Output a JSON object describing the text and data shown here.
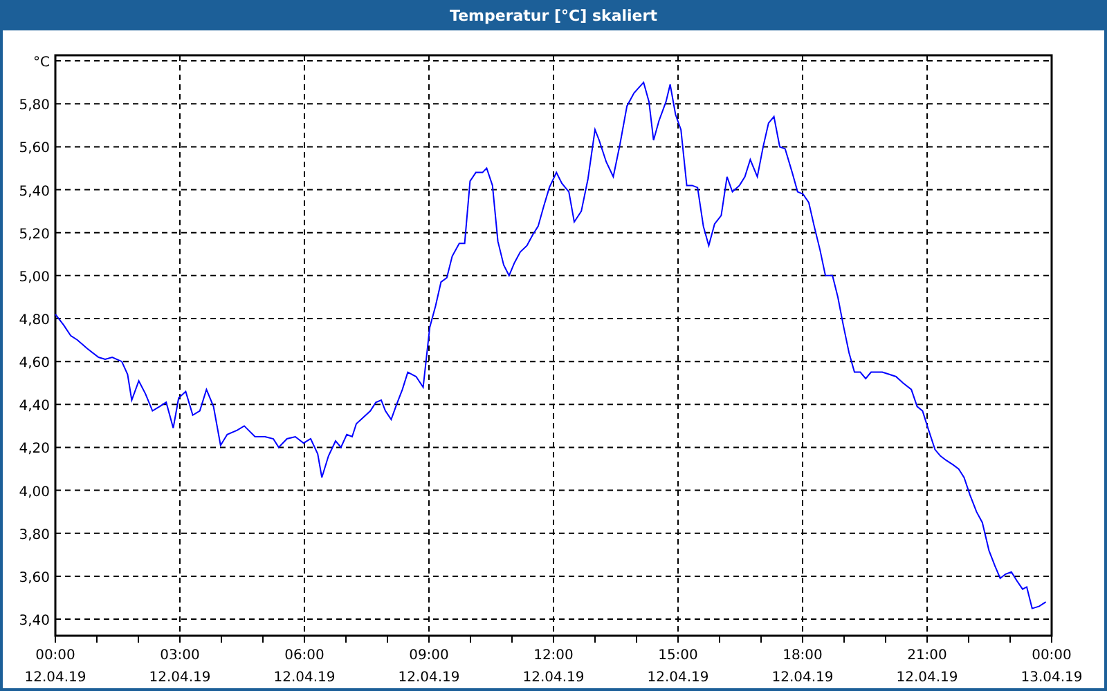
{
  "chart_data": {
    "type": "line",
    "title": "Temperatur [°C] skaliert",
    "grid": true,
    "xlim": [
      0,
      24
    ],
    "ylim": [
      3.323,
      6.026
    ],
    "xticks": [
      {
        "value": 0,
        "label": "00:00"
      },
      {
        "value": 3,
        "label": "03:00"
      },
      {
        "value": 6,
        "label": "06:00"
      },
      {
        "value": 9,
        "label": "09:00"
      },
      {
        "value": 12,
        "label": "12:00"
      },
      {
        "value": 15,
        "label": "15:00"
      },
      {
        "value": 18,
        "label": "18:00"
      },
      {
        "value": 21,
        "label": "21:00"
      },
      {
        "value": 24,
        "label": "00:00"
      }
    ],
    "annotations": [
      "12.04.19",
      "12.04.19",
      "12.04.19",
      "12.04.19",
      "12.04.19",
      "12.04.19",
      "12.04.19",
      "12.04.19",
      "13.04.19"
    ],
    "yticks": [
      {
        "value": 3.4,
        "label": "3,40"
      },
      {
        "value": 3.6,
        "label": "3,60"
      },
      {
        "value": 3.8,
        "label": "3,80"
      },
      {
        "value": 4.0,
        "label": "4,00"
      },
      {
        "value": 4.2,
        "label": "4,20"
      },
      {
        "value": 4.4,
        "label": "4,40"
      },
      {
        "value": 4.6,
        "label": "4,60"
      },
      {
        "value": 4.8,
        "label": "4,80"
      },
      {
        "value": 5.0,
        "label": "5,00"
      },
      {
        "value": 5.2,
        "label": "5,20"
      },
      {
        "value": 5.4,
        "label": "5,40"
      },
      {
        "value": 5.6,
        "label": "5,60"
      },
      {
        "value": 5.8,
        "label": "5,80"
      },
      {
        "value": 6.0,
        "label": "°C"
      }
    ],
    "x": [
      0,
      0.2,
      0.37,
      0.53,
      0.77,
      1.04,
      1.2,
      1.37,
      1.6,
      1.74,
      1.84,
      2.01,
      2.17,
      2.34,
      2.51,
      2.67,
      2.84,
      2.97,
      3.14,
      3.31,
      3.48,
      3.64,
      3.81,
      3.98,
      4.14,
      4.38,
      4.55,
      4.81,
      5.05,
      5.25,
      5.38,
      5.58,
      5.78,
      5.98,
      6.15,
      6.32,
      6.42,
      6.58,
      6.75,
      6.88,
      7.02,
      7.15,
      7.25,
      7.42,
      7.59,
      7.72,
      7.85,
      7.95,
      8.09,
      8.22,
      8.36,
      8.49,
      8.69,
      8.86,
      9.02,
      9.16,
      9.29,
      9.43,
      9.56,
      9.73,
      9.86,
      9.99,
      10.13,
      10.29,
      10.39,
      10.53,
      10.66,
      10.8,
      10.93,
      11.06,
      11.2,
      11.36,
      11.5,
      11.63,
      11.76,
      11.9,
      12.07,
      12.2,
      12.37,
      12.5,
      12.67,
      12.83,
      13,
      13.1,
      13.27,
      13.44,
      13.6,
      13.77,
      13.94,
      14.17,
      14.3,
      14.41,
      14.54,
      14.71,
      14.81,
      14.94,
      15.07,
      15.21,
      15.34,
      15.47,
      15.61,
      15.74,
      15.88,
      16.04,
      16.18,
      16.31,
      16.48,
      16.61,
      16.74,
      16.91,
      17.05,
      17.18,
      17.31,
      17.45,
      17.58,
      17.75,
      17.88,
      18.01,
      18.15,
      18.28,
      18.42,
      18.55,
      18.72,
      18.85,
      18.98,
      19.12,
      19.25,
      19.39,
      19.52,
      19.65,
      19.79,
      19.92,
      20.09,
      20.25,
      20.42,
      20.62,
      20.76,
      20.89,
      21.02,
      21.19,
      21.32,
      21.46,
      21.62,
      21.76,
      21.89,
      22.03,
      22.19,
      22.33,
      22.49,
      22.63,
      22.76,
      22.89,
      23.03,
      23.16,
      23.3,
      23.4,
      23.53,
      23.7,
      23.86
    ],
    "series": [
      {
        "color": "#0000ff",
        "values": [
          4.82,
          4.77,
          4.72,
          4.7,
          4.66,
          4.62,
          4.61,
          4.62,
          4.6,
          4.54,
          4.42,
          4.51,
          4.45,
          4.37,
          4.39,
          4.41,
          4.29,
          4.43,
          4.46,
          4.35,
          4.37,
          4.47,
          4.39,
          4.21,
          4.26,
          4.28,
          4.3,
          4.25,
          4.25,
          4.24,
          4.2,
          4.24,
          4.25,
          4.22,
          4.24,
          4.17,
          4.06,
          4.16,
          4.23,
          4.2,
          4.26,
          4.25,
          4.31,
          4.34,
          4.37,
          4.41,
          4.42,
          4.37,
          4.33,
          4.4,
          4.47,
          4.55,
          4.53,
          4.48,
          4.76,
          4.86,
          4.97,
          4.99,
          5.09,
          5.15,
          5.15,
          5.44,
          5.48,
          5.48,
          5.5,
          5.42,
          5.16,
          5.05,
          5,
          5.06,
          5.11,
          5.14,
          5.19,
          5.23,
          5.32,
          5.41,
          5.48,
          5.43,
          5.39,
          5.25,
          5.3,
          5.45,
          5.68,
          5.63,
          5.53,
          5.46,
          5.61,
          5.79,
          5.85,
          5.9,
          5.81,
          5.63,
          5.72,
          5.81,
          5.89,
          5.75,
          5.68,
          5.42,
          5.42,
          5.41,
          5.23,
          5.14,
          5.24,
          5.28,
          5.46,
          5.39,
          5.42,
          5.46,
          5.54,
          5.46,
          5.6,
          5.71,
          5.74,
          5.6,
          5.59,
          5.48,
          5.39,
          5.38,
          5.34,
          5.23,
          5.12,
          5,
          5,
          4.9,
          4.77,
          4.64,
          4.55,
          4.55,
          4.52,
          4.55,
          4.55,
          4.55,
          4.54,
          4.53,
          4.5,
          4.47,
          4.39,
          4.37,
          4.29,
          4.19,
          4.16,
          4.14,
          4.12,
          4.1,
          4.06,
          3.98,
          3.9,
          3.85,
          3.72,
          3.65,
          3.59,
          3.61,
          3.62,
          3.58,
          3.54,
          3.55,
          3.45,
          3.46,
          3.48
        ]
      }
    ]
  }
}
